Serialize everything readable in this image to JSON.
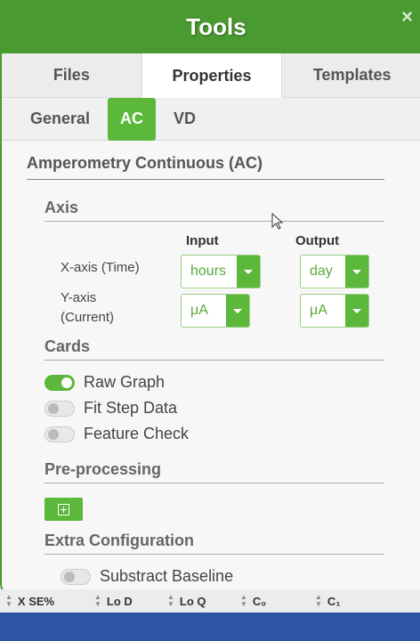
{
  "header": {
    "title": "Tools",
    "close_symbol": "×"
  },
  "tabs": [
    {
      "label": "Files",
      "active": false
    },
    {
      "label": "Properties",
      "active": true
    },
    {
      "label": "Templates",
      "active": false
    }
  ],
  "subtabs": [
    {
      "label": "General",
      "active": false
    },
    {
      "label": "AC",
      "active": true
    },
    {
      "label": "VD",
      "active": false
    }
  ],
  "main": {
    "title": "Amperometry Continuous (AC)",
    "axis": {
      "title": "Axis",
      "input_header": "Input",
      "output_header": "Output",
      "rows": [
        {
          "label_line1": "X-axis (Time)",
          "label_line2": "",
          "input": "hours",
          "output": "day"
        },
        {
          "label_line1": "Y-axis",
          "label_line2": "(Current)",
          "input": "μA",
          "output": "μA"
        }
      ]
    },
    "cards": {
      "title": "Cards",
      "items": [
        {
          "label": "Raw Graph",
          "on": true
        },
        {
          "label": "Fit Step Data",
          "on": false
        },
        {
          "label": "Feature Check",
          "on": false
        }
      ]
    },
    "preprocessing": {
      "title": "Pre-processing"
    },
    "extra": {
      "title": "Extra Configuration",
      "items": [
        {
          "label": "Substract Baseline",
          "on": false
        }
      ]
    }
  },
  "table_header": {
    "columns": [
      "X SE%",
      "Lo D",
      "Lo Q",
      "C₀",
      "C₁"
    ]
  },
  "colors": {
    "accent": "#5cb83a",
    "header": "#4a9a32",
    "bottom_bar": "#2c56a3"
  }
}
